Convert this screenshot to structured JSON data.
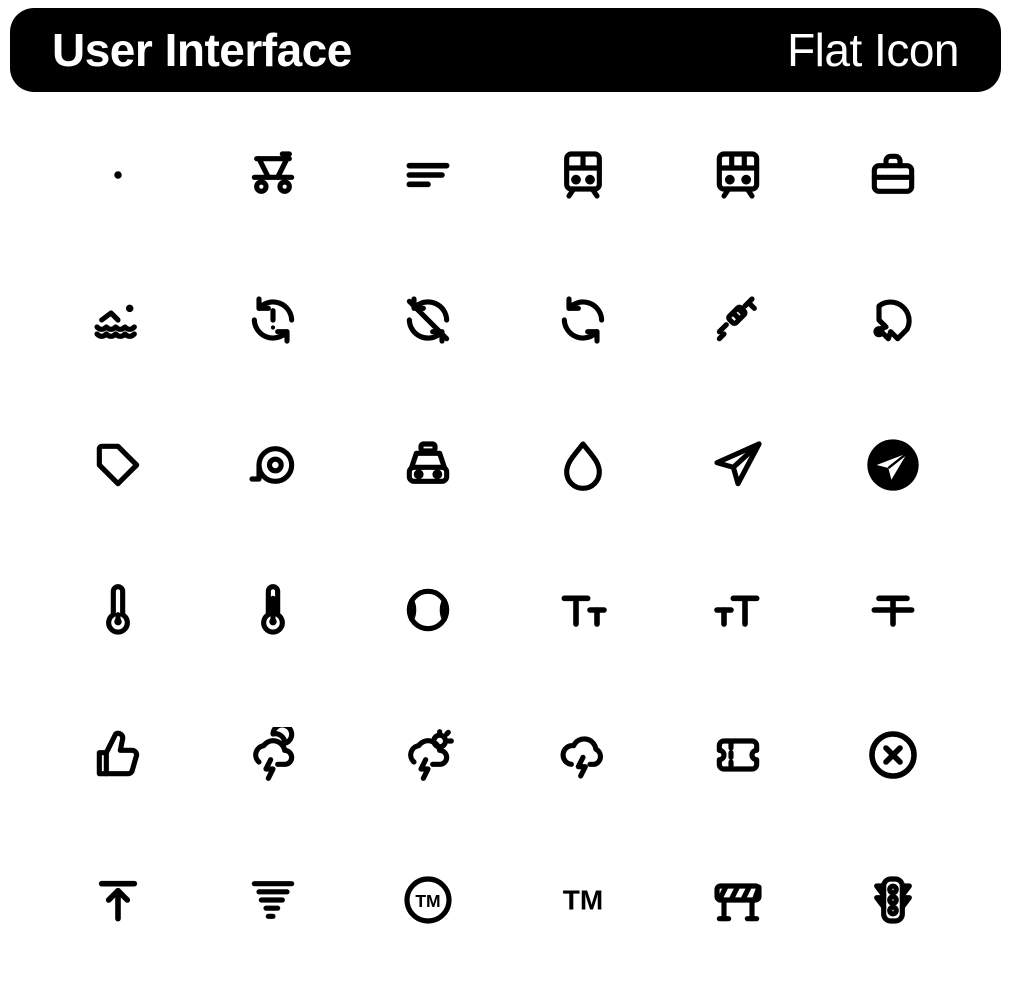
{
  "header": {
    "title_left": "User Interface",
    "title_right": "Flat Icon"
  },
  "icons": [
    "dot-icon",
    "trolley-icon",
    "text-align-left-icon",
    "subway-icon",
    "tram-icon",
    "briefcase-icon",
    "swimming-icon",
    "sync-alert-icon",
    "sync-off-icon",
    "refresh-icon",
    "syringe-icon",
    "table-tennis-icon",
    "tag-icon",
    "tape-measure-icon",
    "taxi-icon",
    "water-drop-icon",
    "send-outline-icon",
    "send-filled-icon",
    "thermometer-cold-icon",
    "thermometer-hot-icon",
    "tennis-ball-icon",
    "text-size-decrease-icon",
    "text-size-increase-icon",
    "strikethrough-icon",
    "thumbs-up-icon",
    "night-storm-icon",
    "day-storm-icon",
    "cloud-lightning-icon",
    "ticket-icon",
    "close-circle-icon",
    "upload-icon",
    "tornado-icon",
    "trademark-circle-icon",
    "trademark-icon",
    "barrier-icon",
    "traffic-light-icon"
  ]
}
